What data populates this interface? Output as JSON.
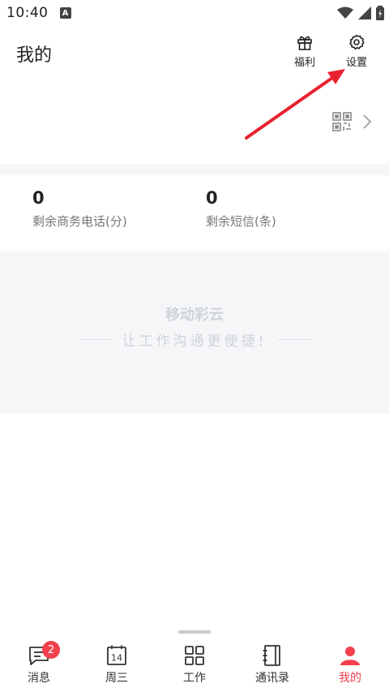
{
  "status": {
    "time": "10:40",
    "a_icon": "A"
  },
  "header": {
    "title": "我的",
    "welfare_label": "福利",
    "settings_label": "设置"
  },
  "stats": [
    {
      "value": "0",
      "label": "剩余商务电话(分)"
    },
    {
      "value": "0",
      "label": "剩余短信(条)"
    }
  ],
  "banner": {
    "title": "移动彩云",
    "subtitle": "让工作沟通更便捷!"
  },
  "tabs": [
    {
      "label": "消息",
      "badge": "2",
      "icon": "message-icon"
    },
    {
      "label": "周三",
      "day": "14",
      "icon": "calendar-icon"
    },
    {
      "label": "工作",
      "icon": "grid-icon"
    },
    {
      "label": "通讯录",
      "icon": "contacts-icon"
    },
    {
      "label": "我的",
      "icon": "profile-icon",
      "active": true
    }
  ],
  "colors": {
    "accent": "#f0414d",
    "band": "#f5f6f8",
    "arrow": "#e8212f"
  }
}
